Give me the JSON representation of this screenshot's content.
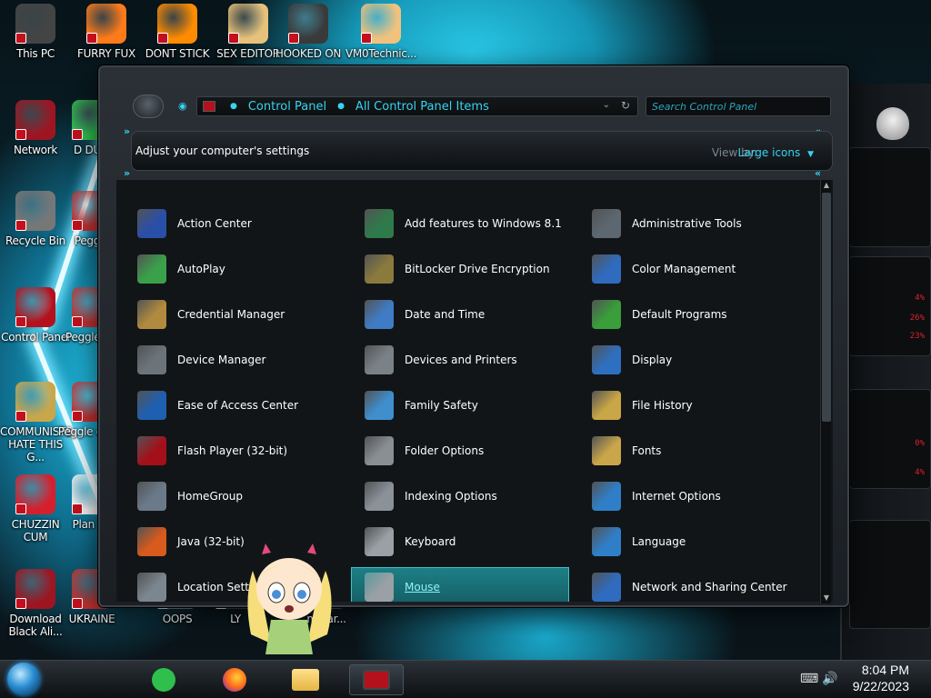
{
  "desktop": {
    "icons": [
      {
        "label": "This PC",
        "icon": "this-pc-icon"
      },
      {
        "label": "FURRY FUX",
        "icon": "firefox-icon"
      },
      {
        "label": "DONT STICK",
        "icon": "vlc-cone-icon"
      },
      {
        "label": "SEX EDITOR",
        "icon": "hxd-editor-icon"
      },
      {
        "label": "HOOKED ON",
        "icon": "hooked-on-game-icon"
      },
      {
        "label": "VM0Technic...",
        "icon": "doctor-avatar-icon"
      },
      {
        "label": "Network",
        "icon": "network-icon"
      },
      {
        "label": "D DUM",
        "icon": "app-icon"
      },
      {
        "label": "Recycle Bin",
        "icon": "recycle-bin-icon"
      },
      {
        "label": "Peggle",
        "icon": "peggle-icon"
      },
      {
        "label": "Control Panel",
        "icon": "control-panel-icon"
      },
      {
        "label": "Peggle De",
        "icon": "peggle-deluxe-icon"
      },
      {
        "label": "COMMUNISTS HATE THIS G...",
        "icon": "money-bag-icon"
      },
      {
        "label": "Peggle of Wa",
        "icon": "peggle-wa-icon"
      },
      {
        "label": "CHUZZIN CUM",
        "icon": "chuzzle-icon"
      },
      {
        "label": "Plan Zo",
        "icon": "plants-zombies-icon"
      },
      {
        "label": "Download Black Ali...",
        "icon": "download-icon"
      },
      {
        "label": "UKRAINE",
        "icon": "ukraine-icon"
      },
      {
        "label": "OOPS",
        "icon": "oops-icon"
      },
      {
        "label": "LY",
        "icon": "ly-icon"
      },
      {
        "label": "mWar...",
        "icon": "mwar-icon"
      }
    ]
  },
  "window": {
    "breadcrumb": [
      "Control Panel",
      "All Control Panel Items"
    ],
    "search_placeholder": "Search Control Panel",
    "header_title": "Adjust your computer's settings",
    "view_by_label": "View by:",
    "view_by_value": "Large icons",
    "items": [
      {
        "label": "Action Center",
        "icon": "flag-icon",
        "color": "#2a4fa8"
      },
      {
        "label": "Add features to Windows 8.1",
        "icon": "add-features-icon",
        "color": "#2f7a4a"
      },
      {
        "label": "Administrative Tools",
        "icon": "admin-tools-icon",
        "color": "#5d6770"
      },
      {
        "label": "AutoPlay",
        "icon": "autoplay-icon",
        "color": "#3aa14a"
      },
      {
        "label": "BitLocker Drive Encryption",
        "icon": "bitlocker-key-icon",
        "color": "#8a7a3c"
      },
      {
        "label": "Color Management",
        "icon": "color-management-icon",
        "color": "#2f6bbf"
      },
      {
        "label": "Credential Manager",
        "icon": "credential-vault-icon",
        "color": "#b08a3e"
      },
      {
        "label": "Date and Time",
        "icon": "clock-calendar-icon",
        "color": "#3f7cc5"
      },
      {
        "label": "Default Programs",
        "icon": "default-programs-icon",
        "color": "#3a9e3a"
      },
      {
        "label": "Device Manager",
        "icon": "device-manager-icon",
        "color": "#6c747b"
      },
      {
        "label": "Devices and Printers",
        "icon": "printer-icon",
        "color": "#7b8287"
      },
      {
        "label": "Display",
        "icon": "monitor-icon",
        "color": "#2e6fbf"
      },
      {
        "label": "Ease of Access Center",
        "icon": "ease-of-access-icon",
        "color": "#1f5fb0"
      },
      {
        "label": "Family Safety",
        "icon": "family-safety-icon",
        "color": "#3f8fcf"
      },
      {
        "label": "File History",
        "icon": "file-history-icon",
        "color": "#c9a646"
      },
      {
        "label": "Flash Player (32-bit)",
        "icon": "flash-player-icon",
        "color": "#a3101a"
      },
      {
        "label": "Folder Options",
        "icon": "folder-options-icon",
        "color": "#8a8f94"
      },
      {
        "label": "Fonts",
        "icon": "fonts-folder-icon",
        "color": "#caa64a"
      },
      {
        "label": "HomeGroup",
        "icon": "homegroup-icon",
        "color": "#6b7a8a"
      },
      {
        "label": "Indexing Options",
        "icon": "indexing-icon",
        "color": "#8a9199"
      },
      {
        "label": "Internet Options",
        "icon": "globe-icon",
        "color": "#2f7fc8"
      },
      {
        "label": "Java (32-bit)",
        "icon": "java-icon",
        "color": "#d85a1c"
      },
      {
        "label": "Keyboard",
        "icon": "keyboard-icon",
        "color": "#9aa0a5"
      },
      {
        "label": "Language",
        "icon": "language-globe-icon",
        "color": "#2f7fc8"
      },
      {
        "label": "Location Settings",
        "icon": "location-icon",
        "color": "#7c868f"
      },
      {
        "label": "Mouse",
        "icon": "mouse-icon",
        "color": "#9aa0a5"
      },
      {
        "label": "Network and Sharing Center",
        "icon": "network-sharing-icon",
        "color": "#2f6bbf"
      }
    ]
  },
  "gadget": {
    "stats": [
      "4%",
      "26%",
      "23%",
      "0%",
      "4%"
    ]
  },
  "taskbar": {
    "time": "8:04 PM",
    "date": "9/22/2023"
  }
}
